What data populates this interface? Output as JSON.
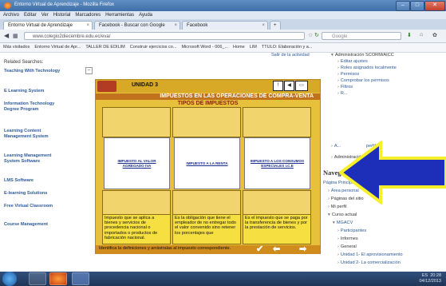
{
  "window": {
    "title": "Entorno Virtual de Aprendizaje - Mozilla Firefox"
  },
  "menu": [
    "Archivo",
    "Editar",
    "Ver",
    "Historial",
    "Marcadores",
    "Herramientas",
    "Ayuda"
  ],
  "tabs": [
    {
      "label": "Entorno Virtual de Aprendizaje"
    },
    {
      "label": "Facebook - Buscar con Google"
    },
    {
      "label": "Facebook"
    },
    {
      "label": "+"
    }
  ],
  "navbar": {
    "url": "www.colegio2diecembre.edu.ec/eva/",
    "search_placeholder": "Google"
  },
  "bookmarks": [
    "Más visitados",
    "Entorno Virtual de Apr...",
    "TALLER DE EDILIM",
    "Construir ejercicios co...",
    "Microsoft Word - 006_...",
    "Home",
    "LIM",
    "TTULO: Elaboración y a..."
  ],
  "left": {
    "related_title": "Related Searches:",
    "items": [
      "Teaching With Technology",
      "E Learning System",
      "Information Technology Degree Program",
      "Learning Content Management System",
      "Learning Management System Software",
      "LMS Software",
      "E-learning Solutions",
      "Free Virtual Classroom",
      "Course Management"
    ]
  },
  "mid": {
    "exit_link": "Salir de la actividad"
  },
  "activity": {
    "unit": "UNIDAD 3",
    "band": "IMPUESTOS EN LAS OPERACIONES DE COMPRA-VENTA",
    "subtitle": "TIPOS DE IMPUESTOS",
    "cards": [
      "IMPUESTO AL VALOR AGREGADO IVA",
      "IMPUESTO A LA RENTA",
      "IMPUESTO A LOS CONSUMOS ESPECIALES I.C.E"
    ],
    "definitions": [
      "Impuesto que se aplica a bienes y servicios de procedencia nacional o importados o productos de fabricación nacional.",
      "Es la obligación que tiene el empleador de no entregar todo el valor convenido sino retener los porcentajes que",
      "Es el impuesto que se paga por la transferencia de bienes y por la prestación de servicios."
    ],
    "instruction": "Identifica la definiciones y arrástralas al impuesto correspondiente.",
    "footer_check": "✔",
    "footer_back": "⬅",
    "footer_next": "➡"
  },
  "right": {
    "admin_items": [
      "Administración SCORM/AICC",
      "Editar ajustes",
      "Roles asignados localmente",
      "Permisos",
      "Comprobar los permisos",
      "Filtros",
      "R..."
    ],
    "admin_partial": [
      "A...",
      "perfil",
      "Administración del sitio"
    ],
    "nav_title": "Navegación",
    "nav_items": [
      {
        "label": "Página Principal",
        "indent": 0
      },
      {
        "label": "Área personal",
        "indent": 1
      },
      {
        "label": "Páginas del sitio",
        "indent": 1
      },
      {
        "label": "Mi perfil",
        "indent": 1
      },
      {
        "label": "Curso actual",
        "indent": 1
      },
      {
        "label": "MGACV",
        "indent": 2
      },
      {
        "label": "Participantes",
        "indent": 3
      },
      {
        "label": "Informes",
        "indent": 3
      },
      {
        "label": "General",
        "indent": 3
      },
      {
        "label": "Unidad 1- El aprovisionamiento",
        "indent": 3
      },
      {
        "label": "Unidad 2- La comercialización",
        "indent": 3
      }
    ]
  },
  "taskbar": {
    "lang": "ES",
    "time": "20:28",
    "date": "04/12/2013"
  },
  "colors": {
    "arrow_fill": "#1d2fb8",
    "arrow_outline": "#f6ef2a",
    "panel": "#e8c13c"
  }
}
